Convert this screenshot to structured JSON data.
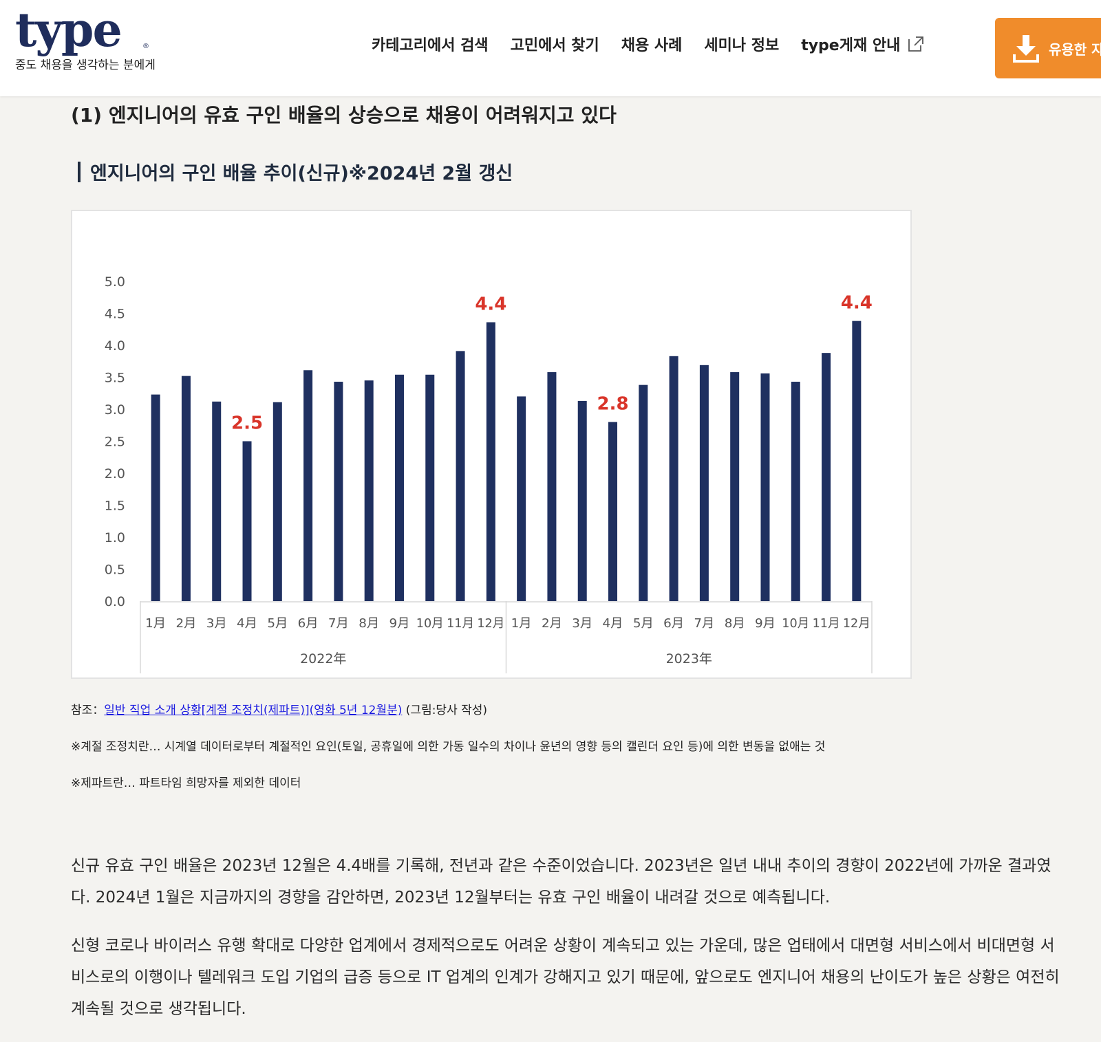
{
  "header": {
    "logo": "type",
    "logo_reg": "®",
    "tagline": "중도 채용을 생각하는 분에게",
    "nav": [
      {
        "label": "카테고리에서 검색"
      },
      {
        "label": "고민에서 찾기"
      },
      {
        "label": "채용 사례"
      },
      {
        "label": "세미나 정보"
      },
      {
        "label": "type게재 안내"
      }
    ],
    "download_label": "유용한 자",
    "colors": {
      "brand": "#1f2d5c",
      "accent": "#f08c2b"
    }
  },
  "section_title": "(1) 엔지니어의 유효 구인 배율의 상승으로 채용이 어려워지고 있다",
  "chart_heading": "엔지니어의 구인 배율 추이(신규)※2024년 2월 갱신",
  "chart_data": {
    "type": "bar",
    "categories": [
      "1月",
      "2月",
      "3月",
      "4月",
      "5月",
      "6月",
      "7月",
      "8月",
      "9月",
      "10月",
      "11月",
      "12月",
      "1月",
      "2月",
      "3月",
      "4月",
      "5月",
      "6月",
      "7月",
      "8月",
      "9月",
      "10月",
      "11月",
      "12月"
    ],
    "groups": [
      {
        "label": "2022年",
        "start": 0,
        "end": 11
      },
      {
        "label": "2023年",
        "start": 12,
        "end": 23
      }
    ],
    "values": [
      3.23,
      3.52,
      3.12,
      2.5,
      3.11,
      3.61,
      3.43,
      3.45,
      3.54,
      3.54,
      3.91,
      4.36,
      3.2,
      3.58,
      3.13,
      2.8,
      3.38,
      3.83,
      3.69,
      3.58,
      3.56,
      3.43,
      3.88,
      4.38
    ],
    "data_labels": [
      {
        "index": 3,
        "text": "2.5"
      },
      {
        "index": 11,
        "text": "4.4"
      },
      {
        "index": 15,
        "text": "2.8"
      },
      {
        "index": 23,
        "text": "4.4"
      }
    ],
    "yticks": [
      "0.0",
      "0.5",
      "1.0",
      "1.5",
      "2.0",
      "2.5",
      "3.0",
      "3.5",
      "4.0",
      "4.5",
      "5.0"
    ],
    "ylim": [
      0,
      5
    ],
    "bar_color": "#1f3060",
    "label_color": "#d9352a",
    "grid": false
  },
  "notes": {
    "ref_prefix": "참조：",
    "ref_link": "일반 직업 소개 상황[계절 조정치(제파트)](영화 5년 12월분)",
    "ref_suffix": " (그림:당사 작성)",
    "note1": "※계절 조정치란… 시계열 데이터로부터 계절적인 요인(토일, 공휴일에 의한 가동 일수의 차이나 윤년의 영향 등의 캘린더 요인 등)에 의한 변동을 없애는 것",
    "note2": "※제파트란… 파트타임 희망자를 제외한 데이터"
  },
  "paragraphs": [
    "신규 유효 구인 배율은 2023년 12월은 4.4배를 기록해, 전년과 같은 수준이었습니다. 2023년은 일년 내내 추이의 경향이 2022년에 가까운 결과였다. 2024년 1월은 지금까지의 경향을 감안하면, 2023년 12월부터는 유효 구인 배율이 내려갈 것으로 예측됩니다.",
    "신형 코로나 바이러스 유행 확대로 다양한 업계에서 경제적으로도 어려운 상황이 계속되고 있는 가운데, 많은 업태에서 대면형 서비스에서 비대면형 서비스로의 이행이나 텔레워크 도입 기업의 급증 등으로 IT 업계의 인계가 강해지고 있기 때문에, 앞으로도 엔지니어 채용의 난이도가 높은 상황은 여전히 계속될 것으로 생각됩니다."
  ]
}
